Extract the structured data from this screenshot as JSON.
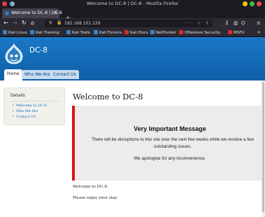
{
  "window": {
    "title": "Welcome to DC-8 | DC-8 - Mozilla Firefox"
  },
  "tabs": [
    {
      "label": "Welcome to DC-8 | DC-8",
      "close": "×"
    }
  ],
  "new_tab": "+",
  "nav": {
    "back": "←",
    "forward": "→",
    "reload": "↻",
    "home": "⌂"
  },
  "address": {
    "url": "192.168.101.129",
    "actions": "··· ☆ ⇩"
  },
  "toolbar": {
    "library": "⫼",
    "sidebar": "▥",
    "extensions": "⛭",
    "menu": "≡"
  },
  "bookmarks": [
    {
      "label": "Kali Linux",
      "color": "#3b82c4"
    },
    {
      "label": "Kali Training",
      "color": "#3b82c4"
    },
    {
      "label": "Kali Tools",
      "color": "#3b82c4"
    },
    {
      "label": "Kali Forums",
      "color": "#3b82c4"
    },
    {
      "label": "Kali Docs",
      "color": "#d62b2b"
    },
    {
      "label": "NetHunter",
      "color": "#3b82c4"
    },
    {
      "label": "Offensive Security",
      "color": "#d62b2b"
    },
    {
      "label": "MSFU",
      "color": "#d62b2b"
    }
  ],
  "bookmarks_more": "»",
  "site": {
    "name": "DC-8",
    "nav": [
      "Home",
      "Who We Are",
      "Contact Us"
    ]
  },
  "sidebar": {
    "title": "Details",
    "links": [
      "Welcome to DC-8",
      "Who We Are",
      "Contact Us"
    ]
  },
  "content": {
    "title": "Welcome to DC-8",
    "notice": {
      "title": "Very Important Message",
      "body": "There will be disruptions to this site over the next few weeks while we resolve a few outstanding issues.",
      "apology": "We apologise for any inconvenience."
    },
    "paragraphs": [
      "Welcome to DC-8.",
      "Please enjoy your stay."
    ]
  },
  "colors": {
    "header_blue": "#1a78c6",
    "notice_border": "#dd1111",
    "link": "#0d6bb8"
  }
}
